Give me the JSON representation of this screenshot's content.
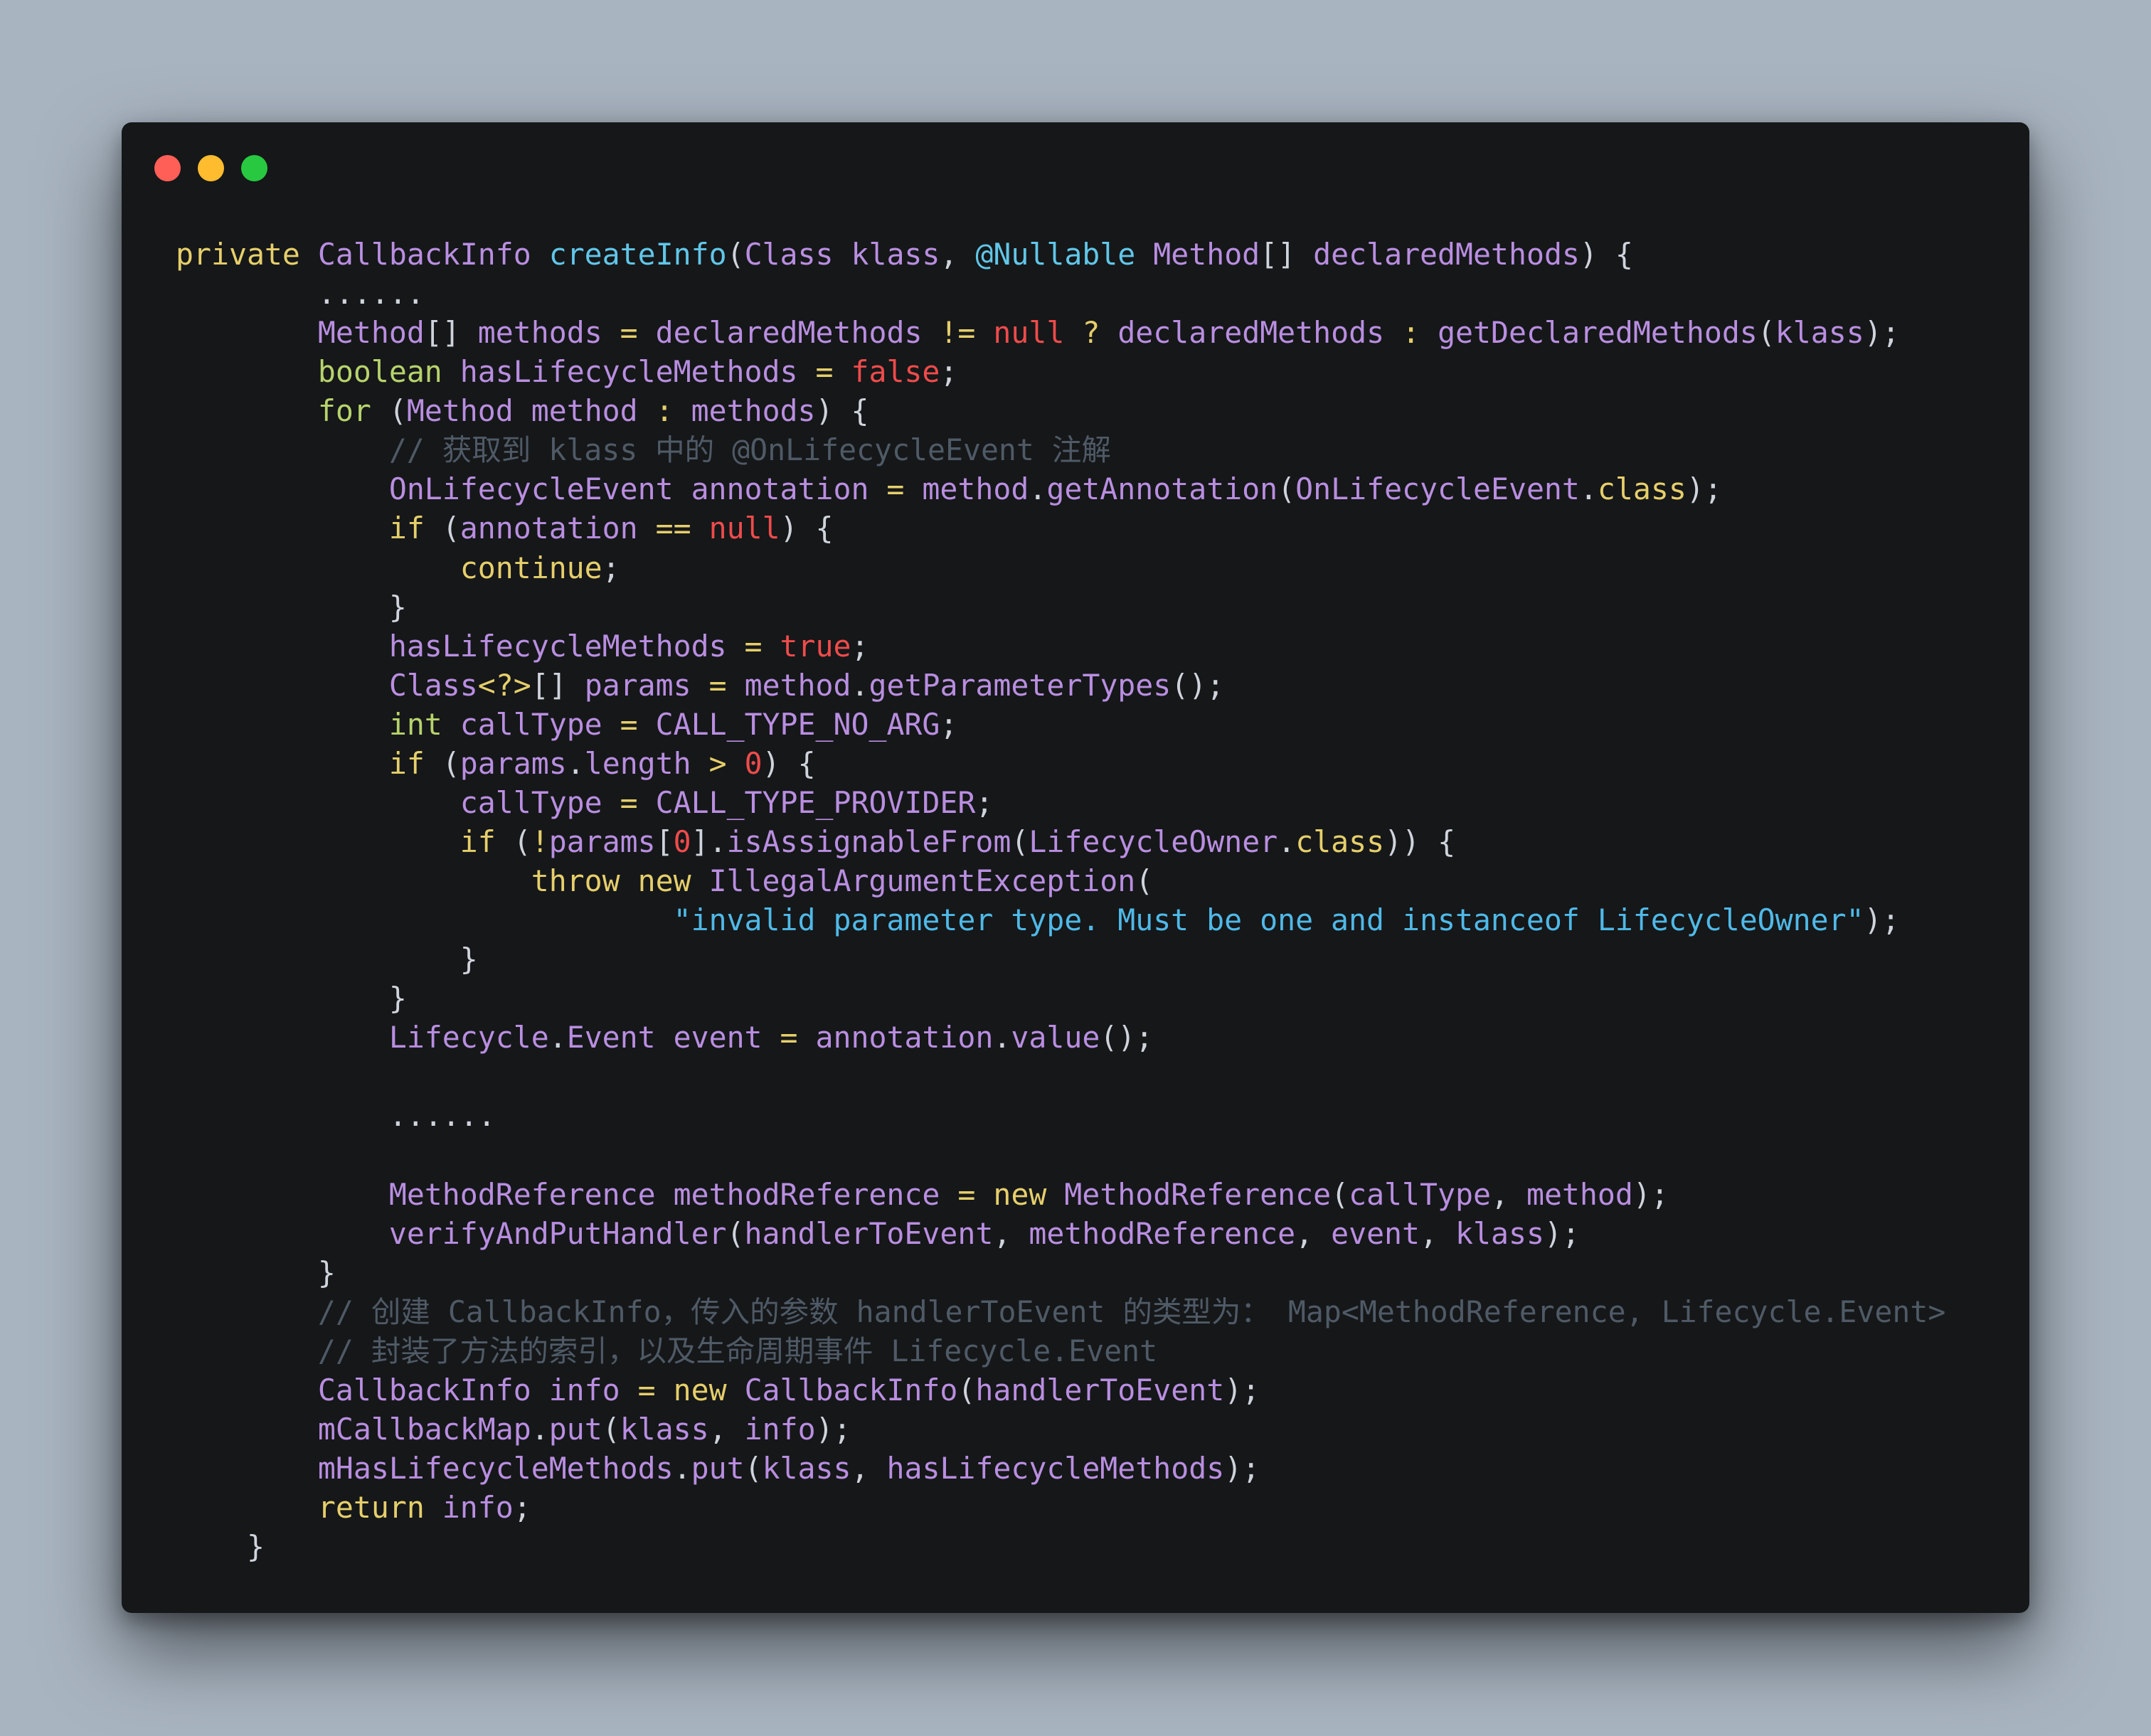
{
  "window": {
    "controls": [
      {
        "name": "close",
        "color": "#ff5f57"
      },
      {
        "name": "minimize",
        "color": "#febc2e"
      },
      {
        "name": "zoom",
        "color": "#28c840"
      }
    ]
  },
  "code": {
    "language": "java",
    "lines": [
      [
        [
          "kw",
          "private "
        ],
        [
          "tp",
          "CallbackInfo "
        ],
        [
          "fd",
          "createInfo"
        ],
        [
          "pn",
          "("
        ],
        [
          "tp",
          "Class klass"
        ],
        [
          "pn",
          ", "
        ],
        [
          "an",
          "@Nullable "
        ],
        [
          "tp",
          "Method"
        ],
        [
          "pn",
          "[] "
        ],
        [
          "tp",
          "declaredMethods"
        ],
        [
          "pn",
          ") {"
        ]
      ],
      [
        [
          "pn",
          "        ......"
        ]
      ],
      [
        [
          "pn",
          "        "
        ],
        [
          "tp",
          "Method"
        ],
        [
          "pn",
          "[] "
        ],
        [
          "tp",
          "methods "
        ],
        [
          "op",
          "= "
        ],
        [
          "tp",
          "declaredMethods "
        ],
        [
          "op",
          "!= "
        ],
        [
          "lt",
          "null "
        ],
        [
          "op",
          "? "
        ],
        [
          "tp",
          "declaredMethods "
        ],
        [
          "op",
          ": "
        ],
        [
          "fn",
          "getDeclaredMethods"
        ],
        [
          "pn",
          "("
        ],
        [
          "tp",
          "klass"
        ],
        [
          "pn",
          ");"
        ]
      ],
      [
        [
          "pn",
          "        "
        ],
        [
          "pr",
          "boolean "
        ],
        [
          "tp",
          "hasLifecycleMethods "
        ],
        [
          "op",
          "= "
        ],
        [
          "lt",
          "false"
        ],
        [
          "pn",
          ";"
        ]
      ],
      [
        [
          "pn",
          "        "
        ],
        [
          "pr",
          "for "
        ],
        [
          "pn",
          "("
        ],
        [
          "tp",
          "Method method "
        ],
        [
          "op",
          ": "
        ],
        [
          "tp",
          "methods"
        ],
        [
          "pn",
          ") {"
        ]
      ],
      [
        [
          "cm",
          "            // 获取到 klass 中的 @OnLifecycleEvent 注解"
        ]
      ],
      [
        [
          "pn",
          "            "
        ],
        [
          "tp",
          "OnLifecycleEvent annotation "
        ],
        [
          "op",
          "= "
        ],
        [
          "tp",
          "method"
        ],
        [
          "pn",
          "."
        ],
        [
          "fn",
          "getAnnotation"
        ],
        [
          "pn",
          "("
        ],
        [
          "tp",
          "OnLifecycleEvent"
        ],
        [
          "pn",
          "."
        ],
        [
          "kw",
          "class"
        ],
        [
          "pn",
          ");"
        ]
      ],
      [
        [
          "pn",
          "            "
        ],
        [
          "kw",
          "if "
        ],
        [
          "pn",
          "("
        ],
        [
          "tp",
          "annotation "
        ],
        [
          "op",
          "== "
        ],
        [
          "lt",
          "null"
        ],
        [
          "pn",
          ") {"
        ]
      ],
      [
        [
          "pn",
          "                "
        ],
        [
          "kw",
          "continue"
        ],
        [
          "pn",
          ";"
        ]
      ],
      [
        [
          "pn",
          "            }"
        ]
      ],
      [
        [
          "pn",
          "            "
        ],
        [
          "tp",
          "hasLifecycleMethods "
        ],
        [
          "op",
          "= "
        ],
        [
          "lt",
          "true"
        ],
        [
          "pn",
          ";"
        ]
      ],
      [
        [
          "pn",
          "            "
        ],
        [
          "tp",
          "Class"
        ],
        [
          "op",
          "<?>"
        ],
        [
          "pn",
          "[] "
        ],
        [
          "tp",
          "params "
        ],
        [
          "op",
          "= "
        ],
        [
          "tp",
          "method"
        ],
        [
          "pn",
          "."
        ],
        [
          "fn",
          "getParameterTypes"
        ],
        [
          "pn",
          "();"
        ]
      ],
      [
        [
          "pn",
          "            "
        ],
        [
          "pr",
          "int "
        ],
        [
          "tp",
          "callType "
        ],
        [
          "op",
          "= "
        ],
        [
          "cn",
          "CALL_TYPE_NO_ARG"
        ],
        [
          "pn",
          ";"
        ]
      ],
      [
        [
          "pn",
          "            "
        ],
        [
          "kw",
          "if "
        ],
        [
          "pn",
          "("
        ],
        [
          "tp",
          "params"
        ],
        [
          "pn",
          "."
        ],
        [
          "tp",
          "length "
        ],
        [
          "op",
          "> "
        ],
        [
          "lt",
          "0"
        ],
        [
          "pn",
          ") {"
        ]
      ],
      [
        [
          "pn",
          "                "
        ],
        [
          "tp",
          "callType "
        ],
        [
          "op",
          "= "
        ],
        [
          "cn",
          "CALL_TYPE_PROVIDER"
        ],
        [
          "pn",
          ";"
        ]
      ],
      [
        [
          "pn",
          "                "
        ],
        [
          "kw",
          "if "
        ],
        [
          "pn",
          "("
        ],
        [
          "op",
          "!"
        ],
        [
          "tp",
          "params"
        ],
        [
          "pn",
          "["
        ],
        [
          "lt",
          "0"
        ],
        [
          "pn",
          "]."
        ],
        [
          "fn",
          "isAssignableFrom"
        ],
        [
          "pn",
          "("
        ],
        [
          "tp",
          "LifecycleOwner"
        ],
        [
          "pn",
          "."
        ],
        [
          "kw",
          "class"
        ],
        [
          "pn",
          ")) {"
        ]
      ],
      [
        [
          "pn",
          "                    "
        ],
        [
          "kw",
          "throw new "
        ],
        [
          "tp",
          "IllegalArgumentException"
        ],
        [
          "pn",
          "("
        ]
      ],
      [
        [
          "pn",
          "                            "
        ],
        [
          "st",
          "\"invalid parameter type. Must be one and instanceof LifecycleOwner\""
        ],
        [
          "pn",
          ");"
        ]
      ],
      [
        [
          "pn",
          "                }"
        ]
      ],
      [
        [
          "pn",
          "            }"
        ]
      ],
      [
        [
          "pn",
          "            "
        ],
        [
          "tp",
          "Lifecycle"
        ],
        [
          "pn",
          "."
        ],
        [
          "tp",
          "Event event "
        ],
        [
          "op",
          "= "
        ],
        [
          "tp",
          "annotation"
        ],
        [
          "pn",
          "."
        ],
        [
          "fn",
          "value"
        ],
        [
          "pn",
          "();"
        ]
      ],
      [
        [
          "pn",
          ""
        ]
      ],
      [
        [
          "pn",
          "            ......"
        ]
      ],
      [
        [
          "pn",
          ""
        ]
      ],
      [
        [
          "pn",
          "            "
        ],
        [
          "tp",
          "MethodReference methodReference "
        ],
        [
          "op",
          "= "
        ],
        [
          "kw",
          "new "
        ],
        [
          "tp",
          "MethodReference"
        ],
        [
          "pn",
          "("
        ],
        [
          "tp",
          "callType"
        ],
        [
          "pn",
          ", "
        ],
        [
          "tp",
          "method"
        ],
        [
          "pn",
          ");"
        ]
      ],
      [
        [
          "pn",
          "            "
        ],
        [
          "fn",
          "verifyAndPutHandler"
        ],
        [
          "pn",
          "("
        ],
        [
          "tp",
          "handlerToEvent"
        ],
        [
          "pn",
          ", "
        ],
        [
          "tp",
          "methodReference"
        ],
        [
          "pn",
          ", "
        ],
        [
          "tp",
          "event"
        ],
        [
          "pn",
          ", "
        ],
        [
          "tp",
          "klass"
        ],
        [
          "pn",
          ");"
        ]
      ],
      [
        [
          "pn",
          "        }"
        ]
      ],
      [
        [
          "cm",
          "        // 创建 CallbackInfo，传入的参数 handlerToEvent 的类型为： Map<MethodReference, Lifecycle.Event>"
        ]
      ],
      [
        [
          "cm",
          "        // 封装了方法的索引，以及生命周期事件 Lifecycle.Event"
        ]
      ],
      [
        [
          "pn",
          "        "
        ],
        [
          "tp",
          "CallbackInfo info "
        ],
        [
          "op",
          "= "
        ],
        [
          "kw",
          "new "
        ],
        [
          "tp",
          "CallbackInfo"
        ],
        [
          "pn",
          "("
        ],
        [
          "tp",
          "handlerToEvent"
        ],
        [
          "pn",
          ");"
        ]
      ],
      [
        [
          "pn",
          "        "
        ],
        [
          "tp",
          "mCallbackMap"
        ],
        [
          "pn",
          "."
        ],
        [
          "fn",
          "put"
        ],
        [
          "pn",
          "("
        ],
        [
          "tp",
          "klass"
        ],
        [
          "pn",
          ", "
        ],
        [
          "tp",
          "info"
        ],
        [
          "pn",
          ");"
        ]
      ],
      [
        [
          "pn",
          "        "
        ],
        [
          "tp",
          "mHasLifecycleMethods"
        ],
        [
          "pn",
          "."
        ],
        [
          "fn",
          "put"
        ],
        [
          "pn",
          "("
        ],
        [
          "tp",
          "klass"
        ],
        [
          "pn",
          ", "
        ],
        [
          "tp",
          "hasLifecycleMethods"
        ],
        [
          "pn",
          ");"
        ]
      ],
      [
        [
          "pn",
          "        "
        ],
        [
          "kw",
          "return "
        ],
        [
          "tp",
          "info"
        ],
        [
          "pn",
          ";"
        ]
      ],
      [
        [
          "pn",
          "    }"
        ]
      ]
    ]
  }
}
